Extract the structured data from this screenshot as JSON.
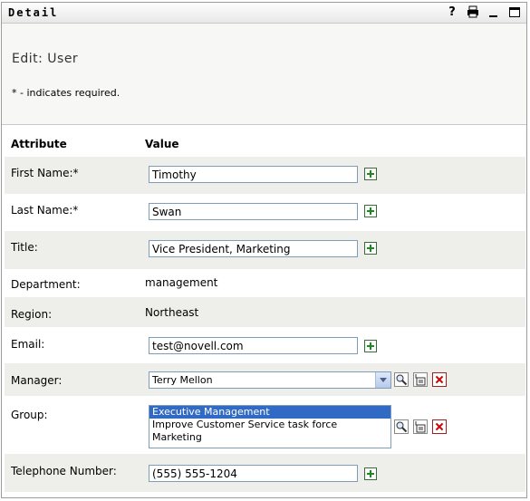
{
  "portlet": {
    "title": "Detail",
    "icons": {
      "help": "?",
      "print": "printer-icon",
      "minimize": "minimize-icon",
      "maximize": "maximize-icon"
    }
  },
  "page": {
    "title": "Edit: User",
    "required_note": "* - indicates required."
  },
  "columns": {
    "attribute": "Attribute",
    "value": "Value"
  },
  "fields": {
    "first_name": {
      "label": "First Name:*",
      "value": "Timothy"
    },
    "last_name": {
      "label": "Last Name:*",
      "value": "Swan"
    },
    "title": {
      "label": "Title:",
      "value": "Vice President, Marketing"
    },
    "department": {
      "label": "Department:",
      "value": "management"
    },
    "region": {
      "label": "Region:",
      "value": "Northeast"
    },
    "email": {
      "label": "Email:",
      "value": "test@novell.com"
    },
    "manager": {
      "label": "Manager:",
      "value": "Terry Mellon"
    },
    "group": {
      "label": "Group:",
      "options": [
        "Executive Management",
        "Improve Customer Service task force",
        "Marketing"
      ],
      "selected": "Executive Management"
    },
    "telephone": {
      "label": "Telephone Number:",
      "value": "(555) 555-1204"
    }
  },
  "colors": {
    "row_shade": "#eeeeea",
    "header_bg": "#f7f7f6",
    "add_icon_green": "#1c8a1c",
    "delete_icon_red": "#d00000",
    "selection_blue": "#316ac5"
  }
}
